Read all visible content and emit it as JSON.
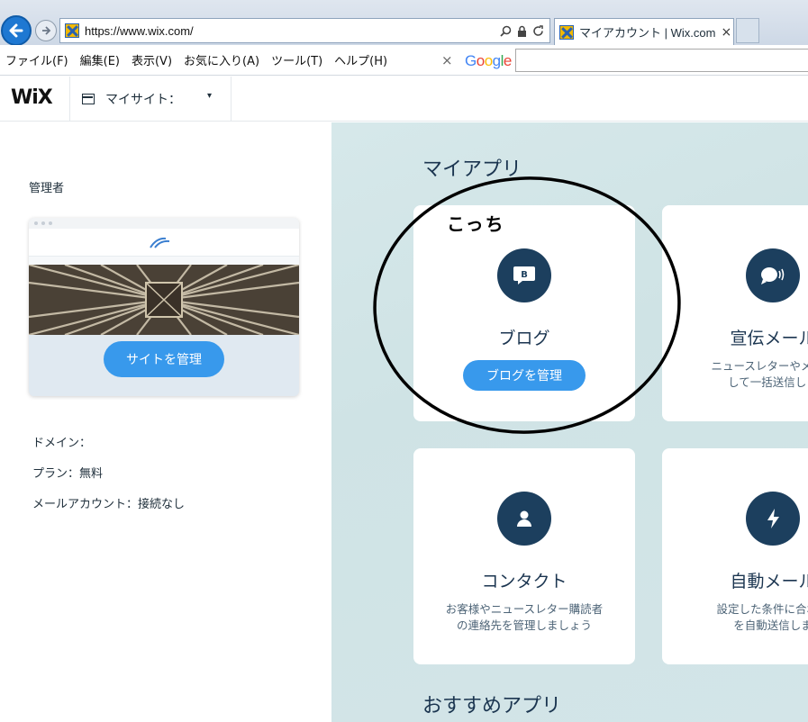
{
  "browser": {
    "url": "https://www.wix.com/",
    "tab_title": "マイアカウント | Wix.com",
    "tab_close": "×",
    "menu": [
      "ファイル(F)",
      "編集(E)",
      "表示(V)",
      "お気に入り(A)",
      "ツール(T)",
      "ヘルプ(H)"
    ],
    "search_bar_close": "×",
    "search_provider": "Google",
    "icons": [
      "back-arrow-icon",
      "forward-arrow-icon",
      "search-icon",
      "lock-icon",
      "refresh-icon"
    ]
  },
  "wix_header": {
    "logo": "WiX",
    "site_label": "マイサイト：",
    "site_caret": "▾"
  },
  "sidebar": {
    "user_name": "",
    "user_role": "管理者",
    "manage_site_button": "サイトを管理",
    "domain_label": "ドメイン：",
    "plan_label": "プラン：",
    "plan_value": "無料",
    "mail_label": "メールアカウント：",
    "mail_value": "接続なし"
  },
  "main": {
    "my_apps_title": "マイアプリ",
    "recommended_title": "おすすめアプリ",
    "apps": [
      {
        "name": "ブログ",
        "button": "ブログを管理",
        "icon": "blog-icon"
      },
      {
        "name": "宣伝メール",
        "desc_1": "ニュースレターやメルマ",
        "desc_2": "して一括送信しま",
        "icon": "speech-bubble-icon"
      },
      {
        "name": "コンタクト",
        "desc_1": "お客様やニュースレター購読者",
        "desc_2": "の連絡先を管理しましょう",
        "icon": "person-icon"
      },
      {
        "name": "自動メール",
        "desc_1": "設定した条件に合わせ",
        "desc_2": "を自動送信しま",
        "icon": "lightning-icon"
      }
    ]
  },
  "annotation": {
    "note": "こっち"
  },
  "colors": {
    "accent": "#3899ec",
    "app_icon_bg": "#1c3f5e",
    "main_bg": "#d3e6e8",
    "heading": "#1b3550"
  }
}
